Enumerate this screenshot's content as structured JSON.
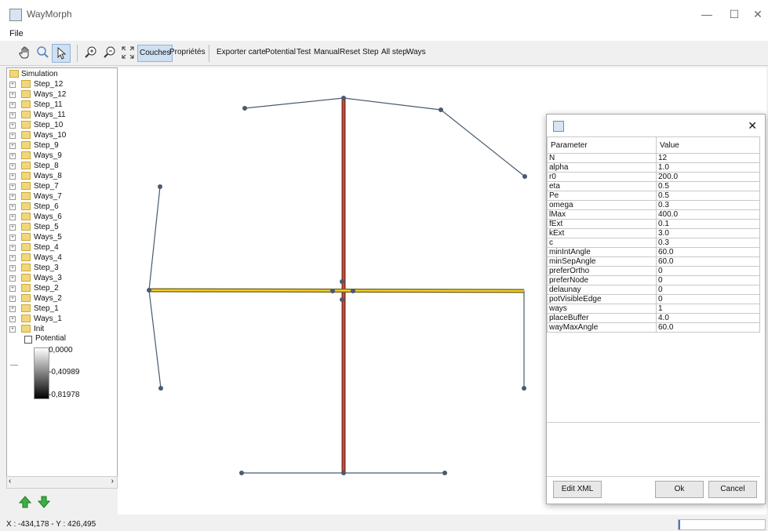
{
  "window": {
    "title": "WayMorph",
    "minimize": "—",
    "maximize": "☐",
    "close": "✕"
  },
  "menu": {
    "file": "File"
  },
  "toolbar": {
    "pan_icon": "hand-icon",
    "zoom_icon": "magnifier-icon",
    "select_icon": "arrow-cursor-icon",
    "zoom_in_icon": "zoom-in-icon",
    "zoom_out_icon": "zoom-out-icon",
    "fit_icon": "fit-extent-icon",
    "couches": "Couches",
    "proprietes": "Propriétés",
    "exporter": "Exporter carte",
    "potential": "Potential",
    "test": "Test",
    "manual": "Manual",
    "reset": "Reset",
    "step": "Step",
    "all_step": "All step",
    "ways": "Ways"
  },
  "tree": {
    "root": "Simulation",
    "items": [
      "Step_12",
      "Ways_12",
      "Step_11",
      "Ways_11",
      "Step_10",
      "Ways_10",
      "Step_9",
      "Ways_9",
      "Step_8",
      "Ways_8",
      "Step_7",
      "Ways_7",
      "Step_6",
      "Ways_6",
      "Step_5",
      "Ways_5",
      "Step_4",
      "Ways_4",
      "Step_3",
      "Ways_3",
      "Step_2",
      "Ways_2",
      "Step_1",
      "Ways_1",
      "Init"
    ],
    "potential_label": "Potential",
    "legend_values": [
      "0,0000",
      "-0,40989",
      "-0,81978"
    ]
  },
  "status": {
    "coords": "X : -434,178 - Y : 426,495"
  },
  "dialog": {
    "col_parameter": "Parameter",
    "col_value": "Value",
    "params": [
      [
        "N",
        "12"
      ],
      [
        "alpha",
        "1.0"
      ],
      [
        "r0",
        "200.0"
      ],
      [
        "eta",
        "0.5"
      ],
      [
        "Pe",
        "0.5"
      ],
      [
        "omega",
        "0.3"
      ],
      [
        "lMax",
        "400.0"
      ],
      [
        "fExt",
        "0.1"
      ],
      [
        "kExt",
        "3.0"
      ],
      [
        "c",
        "0.3"
      ],
      [
        "minIntAngle",
        "60.0"
      ],
      [
        "minSepAngle",
        "60.0"
      ],
      [
        "preferOrtho",
        "0"
      ],
      [
        "preferNode",
        "0"
      ],
      [
        "delaunay",
        "0"
      ],
      [
        "potVisibleEdge",
        "0"
      ],
      [
        "ways",
        "1"
      ],
      [
        "placeBuffer",
        "4.0"
      ],
      [
        "wayMaxAngle",
        "60.0"
      ]
    ],
    "edit_xml": "Edit XML",
    "ok": "Ok",
    "cancel": "Cancel",
    "close": "✕"
  },
  "colors": {
    "red_way": "#b03a2e",
    "yellow_way": "#e8c21a",
    "edge": "#4a5a70"
  }
}
